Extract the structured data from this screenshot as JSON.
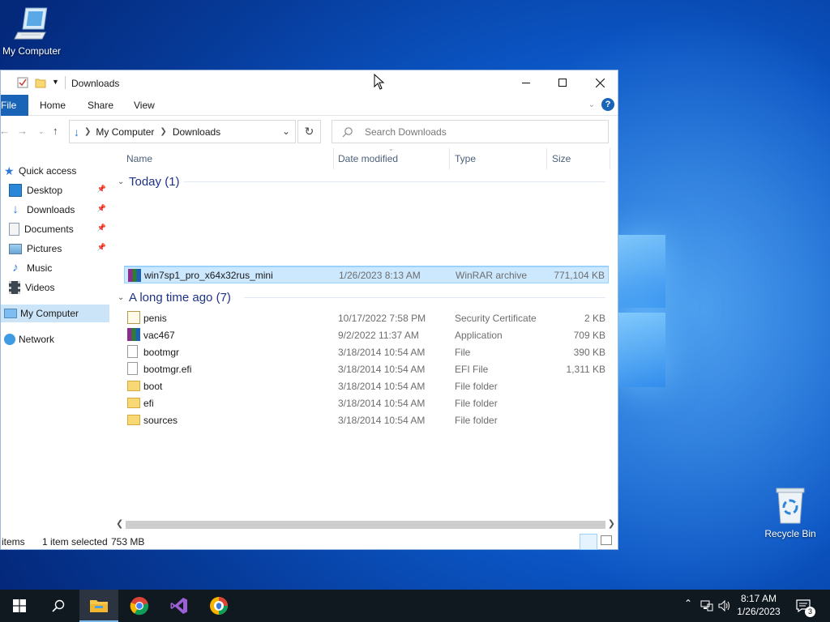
{
  "desktop": {
    "icons": {
      "my_computer": "My Computer",
      "recycle_bin": "Recycle Bin"
    }
  },
  "window": {
    "title": "Downloads",
    "controls": [
      "minimize-icon",
      "maximize-icon",
      "close-icon"
    ]
  },
  "ribbon": {
    "tabs": [
      "File",
      "Home",
      "Share",
      "View"
    ],
    "help_icon": "?"
  },
  "address": {
    "path": [
      "My Computer",
      "Downloads"
    ],
    "search_placeholder": "Search Downloads"
  },
  "nav": {
    "items": [
      {
        "label": "Quick access",
        "icon": "star-icon"
      },
      {
        "label": "Desktop",
        "icon": "desktop-folder-icon",
        "pinned": true
      },
      {
        "label": "Downloads",
        "icon": "downloads-folder-icon",
        "pinned": true
      },
      {
        "label": "Documents",
        "icon": "documents-folder-icon",
        "pinned": true
      },
      {
        "label": "Pictures",
        "icon": "pictures-folder-icon",
        "pinned": true
      },
      {
        "label": "Music",
        "icon": "music-folder-icon"
      },
      {
        "label": "Videos",
        "icon": "videos-folder-icon"
      },
      {
        "label": "My Computer",
        "icon": "computer-icon",
        "selected": true
      },
      {
        "label": "Network",
        "icon": "network-icon"
      }
    ]
  },
  "columns": {
    "name": "Name",
    "date": "Date modified",
    "type": "Type",
    "size": "Size"
  },
  "groups": [
    {
      "label": "Today (1)",
      "files": [
        {
          "name": "win7sp1_pro_x64x32rus_mini",
          "date": "1/26/2023 8:13 AM",
          "type": "WinRAR archive",
          "size": "771,104 KB",
          "icon": "winrar-archive-icon",
          "selected": true
        }
      ]
    },
    {
      "label": "A long time ago (7)",
      "files": [
        {
          "name": "penis",
          "date": "10/17/2022 7:58 PM",
          "type": "Security Certificate",
          "size": "2 KB",
          "icon": "certificate-icon"
        },
        {
          "name": "vac467",
          "date": "9/2/2022 11:37 AM",
          "type": "Application",
          "size": "709 KB",
          "icon": "application-icon"
        },
        {
          "name": "bootmgr",
          "date": "3/18/2014 10:54 AM",
          "type": "File",
          "size": "390 KB",
          "icon": "file-icon"
        },
        {
          "name": "bootmgr.efi",
          "date": "3/18/2014 10:54 AM",
          "type": "EFI File",
          "size": "1,311 KB",
          "icon": "file-icon"
        },
        {
          "name": "boot",
          "date": "3/18/2014 10:54 AM",
          "type": "File folder",
          "size": "",
          "icon": "folder-icon"
        },
        {
          "name": "efi",
          "date": "3/18/2014 10:54 AM",
          "type": "File folder",
          "size": "",
          "icon": "folder-icon"
        },
        {
          "name": "sources",
          "date": "3/18/2014 10:54 AM",
          "type": "File folder",
          "size": "",
          "icon": "folder-icon"
        }
      ]
    }
  ],
  "status": {
    "items": "items",
    "selected": "1 item selected",
    "size": "753 MB"
  },
  "taskbar": {
    "time": "8:17 AM",
    "date": "1/26/2023",
    "notifications": "3"
  },
  "colors": {
    "accent": "#1a64b8",
    "selection": "#cce8ff",
    "taskbar": "#101820"
  }
}
